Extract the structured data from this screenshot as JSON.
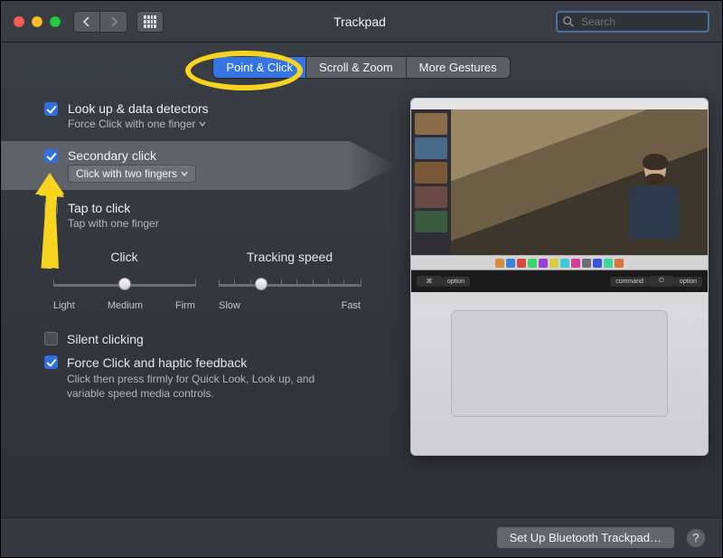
{
  "window": {
    "title": "Trackpad",
    "search_placeholder": "Search"
  },
  "tabs": [
    {
      "label": "Point & Click",
      "selected": true
    },
    {
      "label": "Scroll & Zoom",
      "selected": false
    },
    {
      "label": "More Gestures",
      "selected": false
    }
  ],
  "options": {
    "lookup": {
      "title": "Look up & data detectors",
      "sub": "Force Click with one finger",
      "checked": true
    },
    "secondary": {
      "title": "Secondary click",
      "sub": "Click with two fingers",
      "checked": true
    },
    "tap": {
      "title": "Tap to click",
      "sub": "Tap with one finger",
      "checked": false
    }
  },
  "sliders": {
    "click": {
      "title": "Click",
      "labels": [
        "Light",
        "Medium",
        "Firm"
      ],
      "ticks": 3,
      "value_pct": 50
    },
    "tracking": {
      "title": "Tracking speed",
      "labels": [
        "Slow",
        "Fast"
      ],
      "ticks": 10,
      "value_pct": 30
    }
  },
  "lower": {
    "silent": {
      "title": "Silent clicking",
      "checked": false
    },
    "force": {
      "title": "Force Click and haptic feedback",
      "sub": "Click then press firmly for Quick Look, Look up, and variable speed media controls.",
      "checked": true
    }
  },
  "touchbar_keys": [
    "⌘",
    "option",
    "command",
    "⏻",
    "option"
  ],
  "footer": {
    "setup": "Set Up Bluetooth Trackpad…",
    "help": "?"
  },
  "annotations": {
    "ellipse_target": "tab-point-click",
    "arrow_target": "secondary-click-checkbox"
  }
}
